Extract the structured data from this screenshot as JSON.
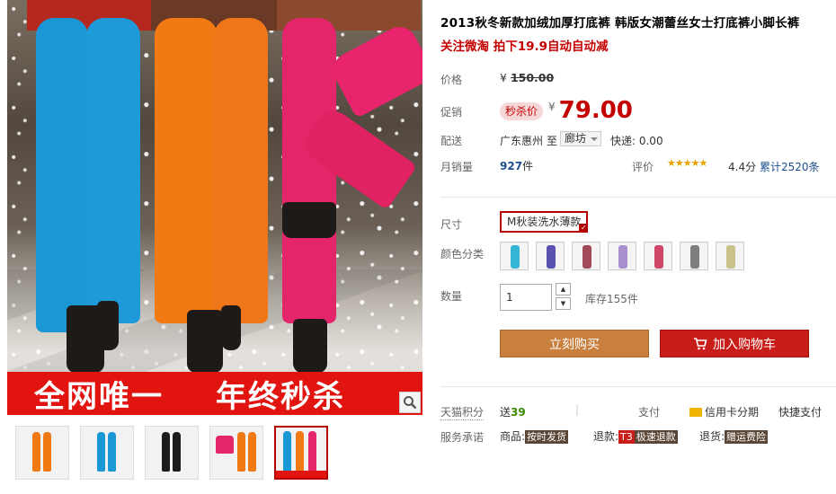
{
  "product": {
    "title": "2013秋冬新款加绒加厚打底裤 韩版女潮蕾丝女士打底裤小脚长裤",
    "subtitle": "关注微淘 拍下19.9自动自动减",
    "banner_left": "全网唯一",
    "banner_right": "年终秒杀"
  },
  "price": {
    "label": "价格",
    "currency": "¥",
    "original": "150.00",
    "promo_label": "促销",
    "sale_tag": "秒杀价",
    "sale": "79.00"
  },
  "delivery": {
    "label": "配送",
    "from": "广东惠州",
    "to_word": "至",
    "dest": "廊坊",
    "express": "快递: 0.00"
  },
  "sales": {
    "label": "月销量",
    "count": "927",
    "unit": "件",
    "rating_label": "评价",
    "stars": "★★★★★",
    "score": "4.4分",
    "reviews": "累计2520条"
  },
  "size": {
    "label": "尺寸",
    "selected": "M秋装洗水薄款"
  },
  "color": {
    "label": "颜色分类",
    "swatches": [
      "#35b6d6",
      "#5a52b0",
      "#a04a5a",
      "#a78fd0",
      "#d0476a",
      "#7d7d7d",
      "#c9c28a"
    ]
  },
  "quantity": {
    "label": "数量",
    "value": "1",
    "stock": "库存155件"
  },
  "actions": {
    "buy": "立刻购买",
    "cart": "加入购物车"
  },
  "points": {
    "label": "天猫积分",
    "send": "送",
    "amount": "39",
    "pay_label": "支付",
    "credit": "信用卡分期",
    "quick": "快捷支付"
  },
  "service": {
    "label": "服务承诺",
    "goods_label": "商品:",
    "goods_tag": "按时发货",
    "refund_label": "退款:",
    "refund_code": "T3",
    "refund_tag": "极速退款",
    "return_label": "退货:",
    "return_tag": "赠运费险"
  },
  "colors": {
    "accent_red": "#c40000",
    "buy_button": "#c9803f",
    "cart_button": "#c81d19",
    "banner_red": "#e1140f"
  }
}
